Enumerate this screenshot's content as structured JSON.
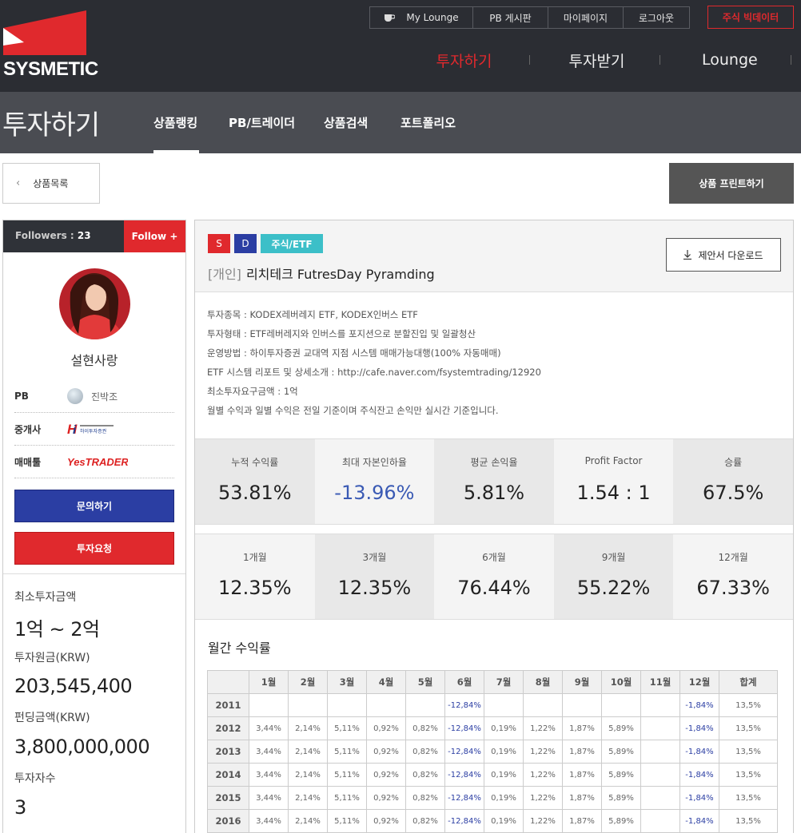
{
  "brand": {
    "name": "SYSMETIC",
    "accent": "#e0292d"
  },
  "top_links": {
    "lounge": "My Lounge",
    "pb_board": "PB 게시판",
    "mypage": "마이페이지",
    "logout": "로그아웃",
    "bigdata": "주식 빅데이터"
  },
  "main_nav": {
    "invest": "투자하기",
    "receive": "투자받기",
    "lounge": "Lounge"
  },
  "sub_header": {
    "title": "투자하기",
    "tabs": [
      "상품랭킹",
      "PB/트레이더",
      "상품검색",
      "포트폴리오"
    ]
  },
  "back_button": "상품목록",
  "print_button": "상품 프린트하기",
  "sidebar": {
    "followers_label": "Followers",
    "followers_count": "23",
    "follow_button": "Follow +",
    "user_name": "설현사랑",
    "pb_label": "PB",
    "pb_name": "진박조",
    "broker_label": "중개사",
    "broker_name": "하이투자증권",
    "tool_label": "매매툴",
    "tool_name": "YesTRADER",
    "inquiry_button": "문의하기",
    "request_button": "투자요청",
    "min_invest_label": "최소투자금액",
    "min_invest_value": "1억 ~ 2억",
    "principal_label": "투자원금(KRW)",
    "principal_value": "203,545,400",
    "funding_label": "펀딩금액(KRW)",
    "funding_value": "3,800,000,000",
    "investors_label": "투자자수",
    "investors_value": "3"
  },
  "product": {
    "tags": [
      "S",
      "D",
      "주식/ETF"
    ],
    "kind": "[개인]",
    "title": "리치테크 FutresDay Pyramding",
    "download_button": "제안서 다운로드",
    "description": [
      "투자종목 : KODEX레버레지 ETF, KODEX인버스 ETF",
      "투자형태 : ETF레버레지와 인버스를 포지션으로 분할진입 및 일괄청산",
      "운영방법 : 하이투자증권 교대역 지점 시스템 매매가능대행(100% 자동매매)",
      "ETF 시스템 리포트 및 상세소개 : http://cafe.naver.com/fsystemtrading/12920",
      "최소투자요구금액 : 1억",
      "월별 수익과 일별 수익은 전일 기준이며 주식잔고 손익만 실시간 기준입니다."
    ]
  },
  "stats_row1": [
    {
      "label": "누적 수익률",
      "value": "53.81%"
    },
    {
      "label": "최대 자본인하율",
      "value": "-13.96%"
    },
    {
      "label": "평균 손익율",
      "value": "5.81%"
    },
    {
      "label": "Profit Factor",
      "value": "1.54 : 1"
    },
    {
      "label": "승률",
      "value": "67.5%"
    }
  ],
  "stats_row2": [
    {
      "label": "1개월",
      "value": "12.35%"
    },
    {
      "label": "3개월",
      "value": "12.35%"
    },
    {
      "label": "6개월",
      "value": "76.44%"
    },
    {
      "label": "9개월",
      "value": "55.22%"
    },
    {
      "label": "12개월",
      "value": "67.33%"
    }
  ],
  "monthly": {
    "title": "월간 수익률",
    "headers": [
      "",
      "1월",
      "2월",
      "3월",
      "4월",
      "5월",
      "6월",
      "7월",
      "8월",
      "9월",
      "10월",
      "11월",
      "12월",
      "합계"
    ],
    "rows": [
      [
        "2011",
        "",
        "",
        "",
        "",
        "",
        "-12,84%",
        "",
        "",
        "",
        "",
        "",
        "-1,84%",
        "13,5%"
      ],
      [
        "2012",
        "3,44%",
        "2,14%",
        "5,11%",
        "0,92%",
        "0,82%",
        "-12,84%",
        "0,19%",
        "1,22%",
        "1,87%",
        "5,89%",
        "",
        "-1,84%",
        "13,5%"
      ],
      [
        "2013",
        "3,44%",
        "2,14%",
        "5,11%",
        "0,92%",
        "0,82%",
        "-12,84%",
        "0,19%",
        "1,22%",
        "1,87%",
        "5,89%",
        "",
        "-1,84%",
        "13,5%"
      ],
      [
        "2014",
        "3,44%",
        "2,14%",
        "5,11%",
        "0,92%",
        "0,82%",
        "-12,84%",
        "0,19%",
        "1,22%",
        "1,87%",
        "5,89%",
        "",
        "-1,84%",
        "13,5%"
      ],
      [
        "2015",
        "3,44%",
        "2,14%",
        "5,11%",
        "0,92%",
        "0,82%",
        "-12,84%",
        "0,19%",
        "1,22%",
        "1,87%",
        "5,89%",
        "",
        "-1,84%",
        "13,5%"
      ],
      [
        "2016",
        "3,44%",
        "2,14%",
        "5,11%",
        "0,92%",
        "0,82%",
        "-12,84%",
        "0,19%",
        "1,22%",
        "1,87%",
        "5,89%",
        "",
        "-1,84%",
        "13,5%"
      ]
    ]
  }
}
